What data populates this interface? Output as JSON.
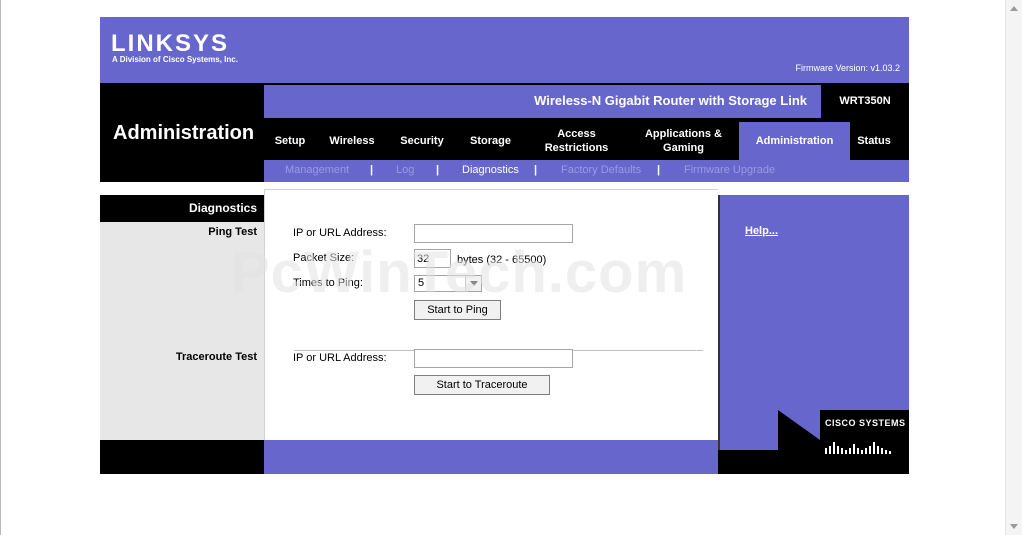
{
  "brand": {
    "logo_text": "LINKSYS",
    "logo_subtitle": "A Division of Cisco Systems, Inc.",
    "firmware": "Firmware Version: v1.03.2"
  },
  "header": {
    "section_title": "Administration",
    "product_name": "Wireless-N Gigabit Router with Storage Link",
    "model": "WRT350N"
  },
  "tabs": [
    {
      "label": "Setup",
      "active": false
    },
    {
      "label": "Wireless",
      "active": false
    },
    {
      "label": "Security",
      "active": false
    },
    {
      "label": "Storage",
      "active": false
    },
    {
      "label": "Access Restrictions",
      "active": false
    },
    {
      "label": "Applications & Gaming",
      "active": false
    },
    {
      "label": "Administration",
      "active": true
    },
    {
      "label": "Status",
      "active": false
    }
  ],
  "subtabs": [
    {
      "label": "Management",
      "active": false
    },
    {
      "label": "Log",
      "active": false
    },
    {
      "label": "Diagnostics",
      "active": true
    },
    {
      "label": "Factory Defaults",
      "active": false
    },
    {
      "label": "Firmware Upgrade",
      "active": false
    }
  ],
  "sidebar": {
    "heading": "Diagnostics",
    "ping_label": "Ping Test",
    "traceroute_label": "Traceroute Test"
  },
  "ping": {
    "ip_label": "IP or URL Address:",
    "ip_value": "",
    "packet_label": "Packet Size:",
    "packet_value": "32",
    "packet_hint": "bytes (32 - 65500)",
    "times_label": "Times to Ping:",
    "times_value": "5",
    "button": "Start to Ping"
  },
  "traceroute": {
    "ip_label": "IP or URL Address:",
    "ip_value": "",
    "button": "Start to Traceroute"
  },
  "help": {
    "link": "Help..."
  },
  "footer": {
    "cisco": "CISCO SYSTEMS"
  },
  "watermark": "PcWinTech.com",
  "colors": {
    "brand_purple": "#6666cc",
    "black": "#000000",
    "sidebar_gray": "#e7e7e7"
  }
}
